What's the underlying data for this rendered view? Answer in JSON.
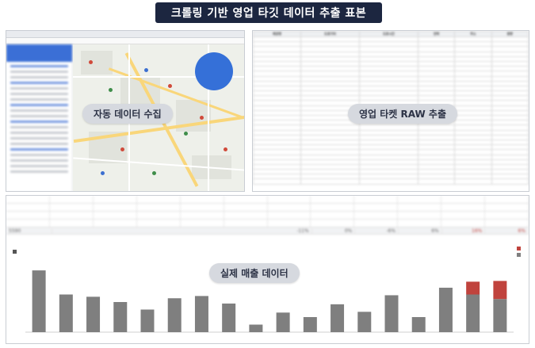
{
  "banner": {
    "title": "크롤링 기반 영업 타깃 데이터 추출 표본"
  },
  "labels": {
    "map": "자동 데이터 수집",
    "table": "영업 타켓 RAW 추출",
    "sales": "실제 매출 데이터"
  },
  "colors": {
    "banner_bg": "#1c2640",
    "bar_gray": "#7f7f7f",
    "bar_red": "#c0433d",
    "map_blue": "#3570d8"
  },
  "table": {
    "headers": [
      "제공명",
      "도로기타",
      "도로시간",
      "연락",
      "주소",
      "중량"
    ],
    "rows": [
      [
        "",
        "",
        "",
        "",
        "",
        ""
      ],
      [
        "",
        "",
        "",
        "",
        "",
        ""
      ],
      [
        "",
        "",
        "",
        "",
        "",
        ""
      ],
      [
        "",
        "",
        "",
        "",
        "",
        ""
      ],
      [
        "",
        "",
        "",
        "",
        "",
        ""
      ],
      [
        "",
        "",
        "",
        "",
        "",
        ""
      ],
      [
        "",
        "",
        "",
        "",
        "",
        ""
      ],
      [
        "",
        "",
        "",
        "",
        "",
        ""
      ],
      [
        "",
        "",
        "",
        "",
        "",
        ""
      ],
      [
        "",
        "",
        "",
        "",
        "",
        ""
      ],
      [
        "",
        "",
        "",
        "",
        "",
        ""
      ],
      [
        "",
        "",
        "",
        "",
        "",
        ""
      ],
      [
        "",
        "",
        "",
        "",
        "",
        ""
      ],
      [
        "",
        "",
        "",
        "",
        "",
        ""
      ],
      [
        "",
        "",
        "",
        "",
        "",
        ""
      ],
      [
        "",
        "",
        "",
        "",
        "",
        ""
      ],
      [
        "",
        "",
        "",
        "",
        "",
        ""
      ],
      [
        "",
        "",
        "",
        "",
        "",
        ""
      ],
      [
        "",
        "",
        "",
        "",
        "",
        ""
      ],
      [
        "",
        "",
        "",
        "",
        "",
        ""
      ],
      [
        "",
        "",
        "",
        "",
        "",
        ""
      ],
      [
        "",
        "",
        "",
        "",
        "",
        ""
      ],
      [
        "",
        "",
        "",
        "",
        "",
        ""
      ],
      [
        "",
        "",
        "",
        "",
        "",
        ""
      ],
      [
        "",
        "",
        "",
        "",
        "",
        ""
      ],
      [
        "",
        "",
        "",
        "",
        "",
        ""
      ],
      [
        "",
        "",
        "",
        "",
        "",
        ""
      ],
      [
        "",
        "",
        "",
        "",
        "",
        ""
      ],
      [
        "",
        "",
        "",
        "",
        "",
        ""
      ],
      [
        "",
        "",
        "",
        "",
        "",
        ""
      ]
    ]
  },
  "sales_summary": {
    "first_cell": "5590",
    "percents": [
      "-11%",
      "0%",
      "-6%",
      "6%",
      "16%",
      "6%"
    ]
  },
  "chart_data": {
    "type": "bar",
    "stacked": true,
    "series": [
      {
        "name": "",
        "values": [
          82,
          50,
          47,
          40,
          30,
          45,
          48,
          38,
          10,
          26,
          20,
          37,
          27,
          49,
          20,
          59,
          50,
          44
        ]
      },
      {
        "name": "",
        "values": [
          0,
          0,
          0,
          0,
          0,
          0,
          0,
          0,
          0,
          0,
          0,
          0,
          0,
          0,
          0,
          0,
          17,
          24
        ]
      }
    ],
    "categories": [
      "",
      "",
      "",
      "",
      "",
      "",
      "",
      "",
      "",
      "",
      "",
      "",
      "",
      "",
      "",
      "",
      "",
      ""
    ],
    "ylim": [
      0,
      100
    ],
    "legend_position": "top-right"
  }
}
